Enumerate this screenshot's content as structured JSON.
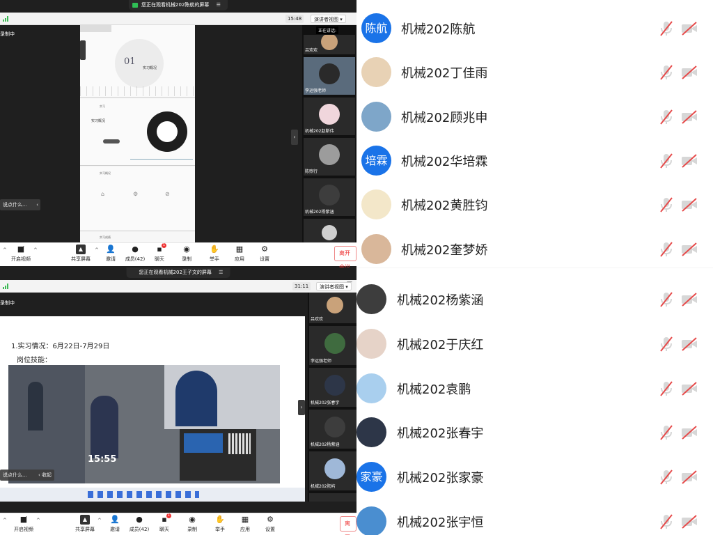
{
  "panel1": {
    "banner": "您正在观看机械202陈航的屏幕",
    "timer": "15:48",
    "view_label": "演讲者视图",
    "recording": "录制中",
    "speaking": "正在讲话:",
    "say_placeholder": "说点什么...",
    "slide": {
      "number": "01",
      "heading": "实习概况",
      "small1": "实习",
      "small2": "实习概况",
      "small3": "实习成绩"
    },
    "tiles": [
      "吕欢欢",
      "李运强老师",
      "机械202赵斯伟",
      "陈煦行",
      "机械202杨紫涵",
      ""
    ],
    "toolbar": [
      {
        "label": "开启视频",
        "icon": "camera-off-icon"
      },
      {
        "label": "共享屏幕",
        "icon": "share-screen-icon"
      },
      {
        "label": "邀请",
        "icon": "invite-icon"
      },
      {
        "label": "成员(42)",
        "icon": "members-icon"
      },
      {
        "label": "聊天",
        "icon": "chat-icon",
        "badge": "1"
      },
      {
        "label": "录制",
        "icon": "record-icon"
      },
      {
        "label": "举手",
        "icon": "raise-hand-icon"
      },
      {
        "label": "应用",
        "icon": "apps-icon"
      },
      {
        "label": "设置",
        "icon": "settings-icon"
      }
    ],
    "leave": "离开会议"
  },
  "panel2": {
    "banner": "您正在观看机械202王子文的屏幕",
    "timer": "31:11",
    "view_label": "演讲者视图",
    "recording": "录制中",
    "say_placeholder": "说点什么...",
    "collapse": "收起",
    "slide": {
      "line1": "1.实习情况：6月22日-7月29日",
      "line2": "岗位技能：",
      "photo_time": "15:55"
    },
    "tiles": [
      "吕欢欢",
      "李运强老师",
      "机械202张春宇",
      "机械202杨紫涵",
      "机械202阮屿",
      ""
    ],
    "toolbar": [
      {
        "label": "开启视频",
        "icon": "camera-off-icon"
      },
      {
        "label": "共享屏幕",
        "icon": "share-screen-icon"
      },
      {
        "label": "邀请",
        "icon": "invite-icon"
      },
      {
        "label": "成员(42)",
        "icon": "members-icon"
      },
      {
        "label": "聊天",
        "icon": "chat-icon",
        "badge": "1"
      },
      {
        "label": "录制",
        "icon": "record-icon"
      },
      {
        "label": "举手",
        "icon": "raise-hand-icon"
      },
      {
        "label": "应用",
        "icon": "apps-icon"
      },
      {
        "label": "设置",
        "icon": "settings-icon"
      }
    ],
    "leave": "离开"
  },
  "participants": [
    {
      "name": "机械202陈航",
      "avatar_text": "陈航",
      "avatar_color": "#1a73e8"
    },
    {
      "name": "机械202丁佳雨",
      "avatar_text": "",
      "avatar_color": "#e8d2b5"
    },
    {
      "name": "机械202顾兆申",
      "avatar_text": "",
      "avatar_color": "#7ea6c9"
    },
    {
      "name": "机械202华培霖",
      "avatar_text": "培霖",
      "avatar_color": "#1a73e8"
    },
    {
      "name": "机械202黄胜钧",
      "avatar_text": "",
      "avatar_color": "#f3e7c9"
    },
    {
      "name": "机械202奎梦娇",
      "avatar_text": "",
      "avatar_color": "#d9b79a"
    },
    {
      "name": "机械202杨紫涵",
      "avatar_text": "",
      "avatar_color": "#3d3d3d"
    },
    {
      "name": "机械202于庆红",
      "avatar_text": "",
      "avatar_color": "#e6d3c8"
    },
    {
      "name": "机械202袁鹏",
      "avatar_text": "",
      "avatar_color": "#a9cfee"
    },
    {
      "name": "机械202张春宇",
      "avatar_text": "",
      "avatar_color": "#2d3648"
    },
    {
      "name": "机械202张家豪",
      "avatar_text": "家豪",
      "avatar_color": "#1a73e8"
    },
    {
      "name": "机械202张宇恒",
      "avatar_text": "",
      "avatar_color": "#4a8ed0"
    }
  ]
}
